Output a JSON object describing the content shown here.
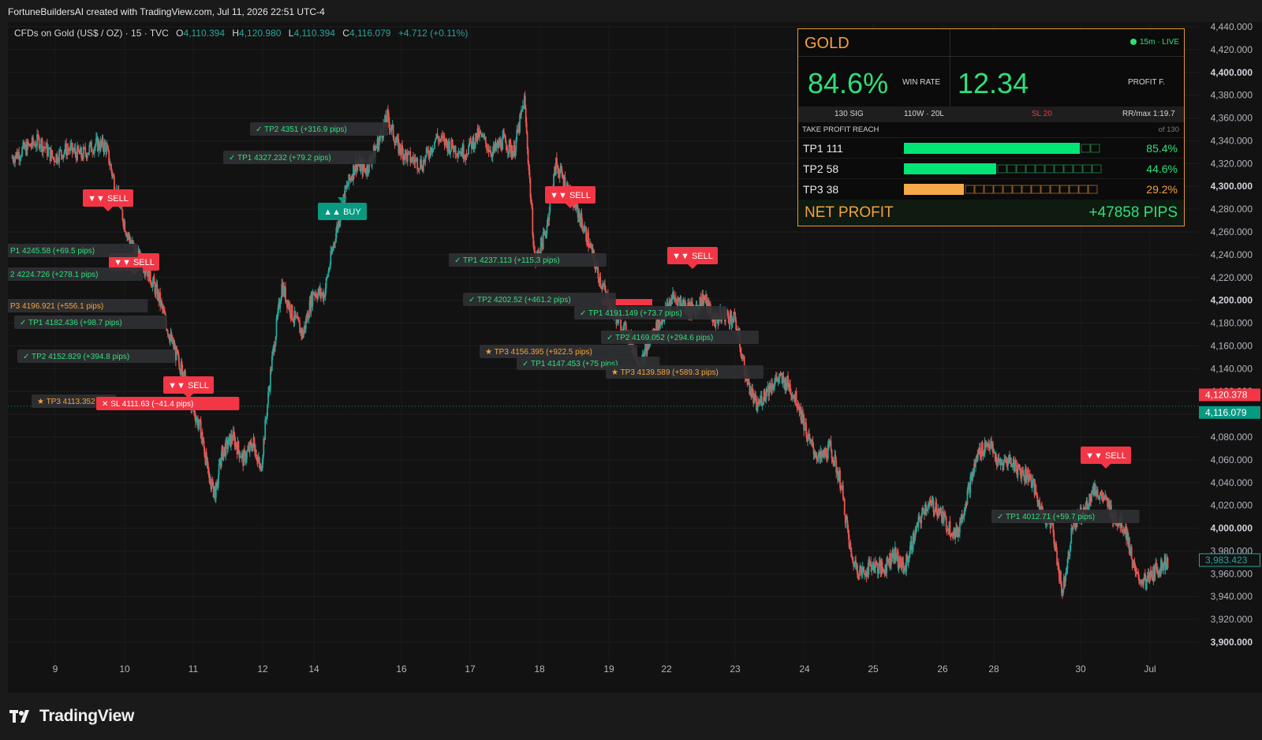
{
  "attribution": "FortuneBuildersAI created with TradingView.com, Jul 11, 2026 22:51 UTC-4",
  "symbol": {
    "name": "CFDs on Gold (US$ / OZ) · 15 · TVC",
    "o_label": "O",
    "o_value": "4,110.394",
    "h_label": "H",
    "h_value": "4,120.980",
    "l_label": "L",
    "l_value": "4,110.394",
    "c_label": "C",
    "c_value": "4,116.079",
    "change": "+4.712 (+0.11%)"
  },
  "chart_data": {
    "type": "candlestick",
    "x_labels": [
      "9",
      "10",
      "11",
      "12",
      "14",
      "16",
      "17",
      "18",
      "19",
      "22",
      "23",
      "24",
      "25",
      "26",
      "28",
      "30",
      "Jul"
    ],
    "y_ticks": [
      "4,440.000",
      "4,420.000",
      "4,400.000",
      "4,380.000",
      "4,360.000",
      "4,340.000",
      "4,320.000",
      "4,300.000",
      "4,280.000",
      "4,260.000",
      "4,240.000",
      "4,220.000",
      "4,200.000",
      "4,180.000",
      "4,160.000",
      "4,140.000",
      "4,120.000",
      "4,100.000",
      "4,080.000",
      "4,060.000",
      "4,040.000",
      "4,020.000",
      "4,000.000",
      "3,980.000",
      "3,960.000",
      "3,940.000",
      "3,920.000",
      "3,900.000"
    ],
    "bold_ticks": [
      "4,400.000",
      "4,300.000",
      "4,200.000",
      "4,100.000",
      "4,000.000",
      "3,900.000"
    ],
    "ylim": [
      3895,
      4443
    ],
    "price_path": [
      [
        0,
        4330
      ],
      [
        0.4,
        4338
      ],
      [
        0.8,
        4345
      ],
      [
        1.2,
        4330
      ],
      [
        1.6,
        4338
      ],
      [
        2,
        4332
      ],
      [
        2.4,
        4342
      ],
      [
        2.7,
        4340
      ],
      [
        3,
        4300
      ],
      [
        3.3,
        4265
      ],
      [
        3.6,
        4245
      ],
      [
        3.9,
        4232
      ],
      [
        4.2,
        4210
      ],
      [
        4.5,
        4178
      ],
      [
        4.7,
        4160
      ],
      [
        4.9,
        4145
      ],
      [
        5.1,
        4120
      ],
      [
        5.4,
        4095
      ],
      [
        5.6,
        4060
      ],
      [
        5.8,
        4040
      ],
      [
        6,
        4075
      ],
      [
        6.3,
        4090
      ],
      [
        6.6,
        4070
      ],
      [
        6.9,
        4085
      ],
      [
        7.1,
        4060
      ],
      [
        7.4,
        4150
      ],
      [
        7.7,
        4220
      ],
      [
        8,
        4195
      ],
      [
        8.3,
        4178
      ],
      [
        8.6,
        4215
      ],
      [
        8.9,
        4212
      ],
      [
        9.2,
        4260
      ],
      [
        9.5,
        4300
      ],
      [
        9.8,
        4325
      ],
      [
        10.1,
        4320
      ],
      [
        10.4,
        4340
      ],
      [
        10.7,
        4365
      ],
      [
        11,
        4340
      ],
      [
        11.3,
        4330
      ],
      [
        11.7,
        4325
      ],
      [
        12.1,
        4348
      ],
      [
        12.5,
        4340
      ],
      [
        12.9,
        4335
      ],
      [
        13.3,
        4350
      ],
      [
        13.7,
        4335
      ],
      [
        14,
        4345
      ],
      [
        14.3,
        4335
      ],
      [
        14.6,
        4380
      ],
      [
        14.9,
        4240
      ],
      [
        15.2,
        4265
      ],
      [
        15.5,
        4325
      ],
      [
        15.8,
        4305
      ],
      [
        16.1,
        4285
      ],
      [
        16.4,
        4260
      ],
      [
        16.7,
        4230
      ],
      [
        17,
        4205
      ],
      [
        17.3,
        4188
      ],
      [
        17.6,
        4175
      ],
      [
        17.9,
        4150
      ],
      [
        18.2,
        4175
      ],
      [
        18.5,
        4190
      ],
      [
        18.8,
        4210
      ],
      [
        19.1,
        4205
      ],
      [
        19.4,
        4198
      ],
      [
        19.7,
        4210
      ],
      [
        20,
        4190
      ],
      [
        20.3,
        4195
      ],
      [
        20.6,
        4190
      ],
      [
        20.9,
        4142
      ],
      [
        21.2,
        4115
      ],
      [
        21.5,
        4130
      ],
      [
        21.8,
        4140
      ],
      [
        22.1,
        4135
      ],
      [
        22.4,
        4118
      ],
      [
        22.7,
        4085
      ],
      [
        23,
        4070
      ],
      [
        23.3,
        4080
      ],
      [
        23.6,
        4050
      ],
      [
        23.9,
        3985
      ],
      [
        24.2,
        3972
      ],
      [
        24.5,
        3980
      ],
      [
        24.8,
        3975
      ],
      [
        25.1,
        3990
      ],
      [
        25.4,
        3975
      ],
      [
        25.7,
        4005
      ],
      [
        26,
        4030
      ],
      [
        26.3,
        4030
      ],
      [
        26.6,
        4015
      ],
      [
        26.9,
        4005
      ],
      [
        27.2,
        4040
      ],
      [
        27.5,
        4075
      ],
      [
        27.8,
        4085
      ],
      [
        28.1,
        4065
      ],
      [
        28.4,
        4070
      ],
      [
        28.7,
        4060
      ],
      [
        29,
        4055
      ],
      [
        29.3,
        4025
      ],
      [
        29.6,
        4015
      ],
      [
        29.9,
        3955
      ],
      [
        30.2,
        4015
      ],
      [
        30.5,
        4025
      ],
      [
        30.8,
        4045
      ],
      [
        31.1,
        4035
      ],
      [
        31.4,
        4020
      ],
      [
        31.7,
        4010
      ],
      [
        32,
        3968
      ],
      [
        32.3,
        3965
      ],
      [
        32.6,
        3976
      ],
      [
        32.9,
        3983
      ]
    ],
    "x_domain": [
      0,
      33
    ],
    "current_labels": [
      {
        "value": "4,120.378",
        "color": "#f23645"
      },
      {
        "value": "4,116.079",
        "color": "#089981"
      },
      {
        "value": "3,983.423",
        "color": "#26a69a"
      }
    ],
    "annotations": {
      "sell_text": "▼▼ SELL",
      "buy_text": "▲▲ BUY",
      "tp_labels": [
        {
          "text": "✓ TP2  4351  (+316.9 pips)",
          "kind": "tp"
        },
        {
          "text": "✓ TP1  4327.232  (+79.2 pips)",
          "kind": "tp"
        },
        {
          "text": "P1  4245.58  (+69.5 pips)",
          "kind": "tp"
        },
        {
          "text": "2  4224.726  (+278.1 pips)",
          "kind": "tp"
        },
        {
          "text": "P3  4196.921  (+556.1 pips)",
          "kind": "tp3"
        },
        {
          "text": "✓ TP1  4182.436  (+98.7 pips)",
          "kind": "tp"
        },
        {
          "text": "✓ TP2  4152.829  (+394.8 pips)",
          "kind": "tp"
        },
        {
          "text": "★ TP3  4113.352",
          "kind": "tp3"
        },
        {
          "text": "✕ SL  4111.63  (−41.4 pips)",
          "kind": "sl"
        },
        {
          "text": "✓ TP1  4237.113  (+115.3 pips)",
          "kind": "tp"
        },
        {
          "text": "✓ TP2  4202.52  (+461.2 pips)",
          "kind": "tp"
        },
        {
          "text": "✓ TP1  4191.149  (+73.7 pips)",
          "kind": "tp"
        },
        {
          "text": "✓ TP2  4169.052  (+294.6 pips)",
          "kind": "tp"
        },
        {
          "text": "★ TP3  4156.395  (+922.5 pips)",
          "kind": "tp3"
        },
        {
          "text": "✓ TP1  4147.453  (+75 pips)",
          "kind": "tp"
        },
        {
          "text": "★ TP3  4139.589  (+589.3 pips)",
          "kind": "tp3"
        },
        {
          "text": "✓ TP1  4012.71  (+59.7 pips)",
          "kind": "tp"
        }
      ]
    }
  },
  "panel": {
    "title": "GOLD",
    "live": "15m · LIVE",
    "win_rate": "84.6%",
    "win_rate_label": "WIN RATE",
    "profit_factor": "12.34",
    "profit_factor_label": "PROFIT F.",
    "signals": "130 SIG",
    "wl": "110W · 20L",
    "sl": "SL  20",
    "rr": "RR/max  1:19.7",
    "tp_reach_label": "TAKE PROFIT REACH",
    "of_total": "of 130",
    "tp_rows": [
      {
        "name": "TP1  111",
        "pct": "85.4%",
        "fraction": 0.854,
        "color": "#00e676",
        "pct_color": "#2ee07a"
      },
      {
        "name": "TP2  58",
        "pct": "44.6%",
        "fraction": 0.446,
        "color": "#00e676",
        "pct_color": "#2ee07a"
      },
      {
        "name": "TP3  38",
        "pct": "29.2%",
        "fraction": 0.292,
        "color": "#f7a94a",
        "pct_color": "#f5a33b"
      }
    ],
    "net_profit_label": "NET PROFIT",
    "net_profit": "+47858 PIPS"
  },
  "brand": "TradingView"
}
